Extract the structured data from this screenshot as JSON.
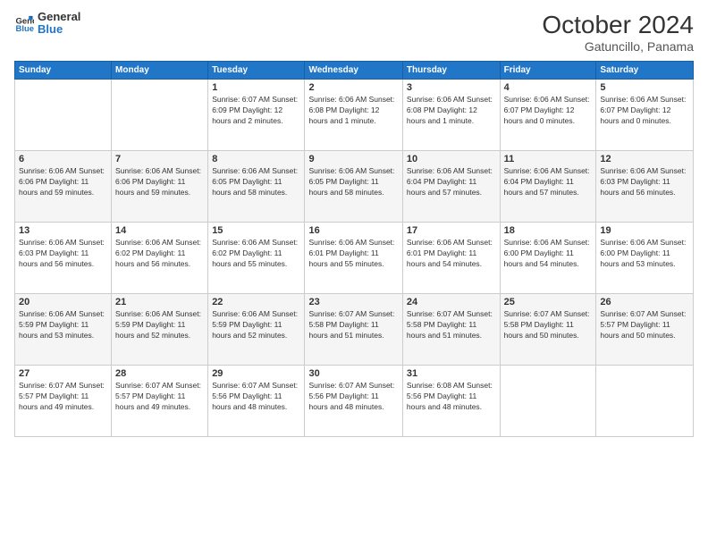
{
  "header": {
    "logo_line1": "General",
    "logo_line2": "Blue",
    "month": "October 2024",
    "location": "Gatuncillo, Panama"
  },
  "weekdays": [
    "Sunday",
    "Monday",
    "Tuesday",
    "Wednesday",
    "Thursday",
    "Friday",
    "Saturday"
  ],
  "weeks": [
    [
      {
        "day": "",
        "info": ""
      },
      {
        "day": "",
        "info": ""
      },
      {
        "day": "1",
        "info": "Sunrise: 6:07 AM\nSunset: 6:09 PM\nDaylight: 12 hours\nand 2 minutes."
      },
      {
        "day": "2",
        "info": "Sunrise: 6:06 AM\nSunset: 6:08 PM\nDaylight: 12 hours\nand 1 minute."
      },
      {
        "day": "3",
        "info": "Sunrise: 6:06 AM\nSunset: 6:08 PM\nDaylight: 12 hours\nand 1 minute."
      },
      {
        "day": "4",
        "info": "Sunrise: 6:06 AM\nSunset: 6:07 PM\nDaylight: 12 hours\nand 0 minutes."
      },
      {
        "day": "5",
        "info": "Sunrise: 6:06 AM\nSunset: 6:07 PM\nDaylight: 12 hours\nand 0 minutes."
      }
    ],
    [
      {
        "day": "6",
        "info": "Sunrise: 6:06 AM\nSunset: 6:06 PM\nDaylight: 11 hours\nand 59 minutes."
      },
      {
        "day": "7",
        "info": "Sunrise: 6:06 AM\nSunset: 6:06 PM\nDaylight: 11 hours\nand 59 minutes."
      },
      {
        "day": "8",
        "info": "Sunrise: 6:06 AM\nSunset: 6:05 PM\nDaylight: 11 hours\nand 58 minutes."
      },
      {
        "day": "9",
        "info": "Sunrise: 6:06 AM\nSunset: 6:05 PM\nDaylight: 11 hours\nand 58 minutes."
      },
      {
        "day": "10",
        "info": "Sunrise: 6:06 AM\nSunset: 6:04 PM\nDaylight: 11 hours\nand 57 minutes."
      },
      {
        "day": "11",
        "info": "Sunrise: 6:06 AM\nSunset: 6:04 PM\nDaylight: 11 hours\nand 57 minutes."
      },
      {
        "day": "12",
        "info": "Sunrise: 6:06 AM\nSunset: 6:03 PM\nDaylight: 11 hours\nand 56 minutes."
      }
    ],
    [
      {
        "day": "13",
        "info": "Sunrise: 6:06 AM\nSunset: 6:03 PM\nDaylight: 11 hours\nand 56 minutes."
      },
      {
        "day": "14",
        "info": "Sunrise: 6:06 AM\nSunset: 6:02 PM\nDaylight: 11 hours\nand 56 minutes."
      },
      {
        "day": "15",
        "info": "Sunrise: 6:06 AM\nSunset: 6:02 PM\nDaylight: 11 hours\nand 55 minutes."
      },
      {
        "day": "16",
        "info": "Sunrise: 6:06 AM\nSunset: 6:01 PM\nDaylight: 11 hours\nand 55 minutes."
      },
      {
        "day": "17",
        "info": "Sunrise: 6:06 AM\nSunset: 6:01 PM\nDaylight: 11 hours\nand 54 minutes."
      },
      {
        "day": "18",
        "info": "Sunrise: 6:06 AM\nSunset: 6:00 PM\nDaylight: 11 hours\nand 54 minutes."
      },
      {
        "day": "19",
        "info": "Sunrise: 6:06 AM\nSunset: 6:00 PM\nDaylight: 11 hours\nand 53 minutes."
      }
    ],
    [
      {
        "day": "20",
        "info": "Sunrise: 6:06 AM\nSunset: 5:59 PM\nDaylight: 11 hours\nand 53 minutes."
      },
      {
        "day": "21",
        "info": "Sunrise: 6:06 AM\nSunset: 5:59 PM\nDaylight: 11 hours\nand 52 minutes."
      },
      {
        "day": "22",
        "info": "Sunrise: 6:06 AM\nSunset: 5:59 PM\nDaylight: 11 hours\nand 52 minutes."
      },
      {
        "day": "23",
        "info": "Sunrise: 6:07 AM\nSunset: 5:58 PM\nDaylight: 11 hours\nand 51 minutes."
      },
      {
        "day": "24",
        "info": "Sunrise: 6:07 AM\nSunset: 5:58 PM\nDaylight: 11 hours\nand 51 minutes."
      },
      {
        "day": "25",
        "info": "Sunrise: 6:07 AM\nSunset: 5:58 PM\nDaylight: 11 hours\nand 50 minutes."
      },
      {
        "day": "26",
        "info": "Sunrise: 6:07 AM\nSunset: 5:57 PM\nDaylight: 11 hours\nand 50 minutes."
      }
    ],
    [
      {
        "day": "27",
        "info": "Sunrise: 6:07 AM\nSunset: 5:57 PM\nDaylight: 11 hours\nand 49 minutes."
      },
      {
        "day": "28",
        "info": "Sunrise: 6:07 AM\nSunset: 5:57 PM\nDaylight: 11 hours\nand 49 minutes."
      },
      {
        "day": "29",
        "info": "Sunrise: 6:07 AM\nSunset: 5:56 PM\nDaylight: 11 hours\nand 48 minutes."
      },
      {
        "day": "30",
        "info": "Sunrise: 6:07 AM\nSunset: 5:56 PM\nDaylight: 11 hours\nand 48 minutes."
      },
      {
        "day": "31",
        "info": "Sunrise: 6:08 AM\nSunset: 5:56 PM\nDaylight: 11 hours\nand 48 minutes."
      },
      {
        "day": "",
        "info": ""
      },
      {
        "day": "",
        "info": ""
      }
    ]
  ]
}
